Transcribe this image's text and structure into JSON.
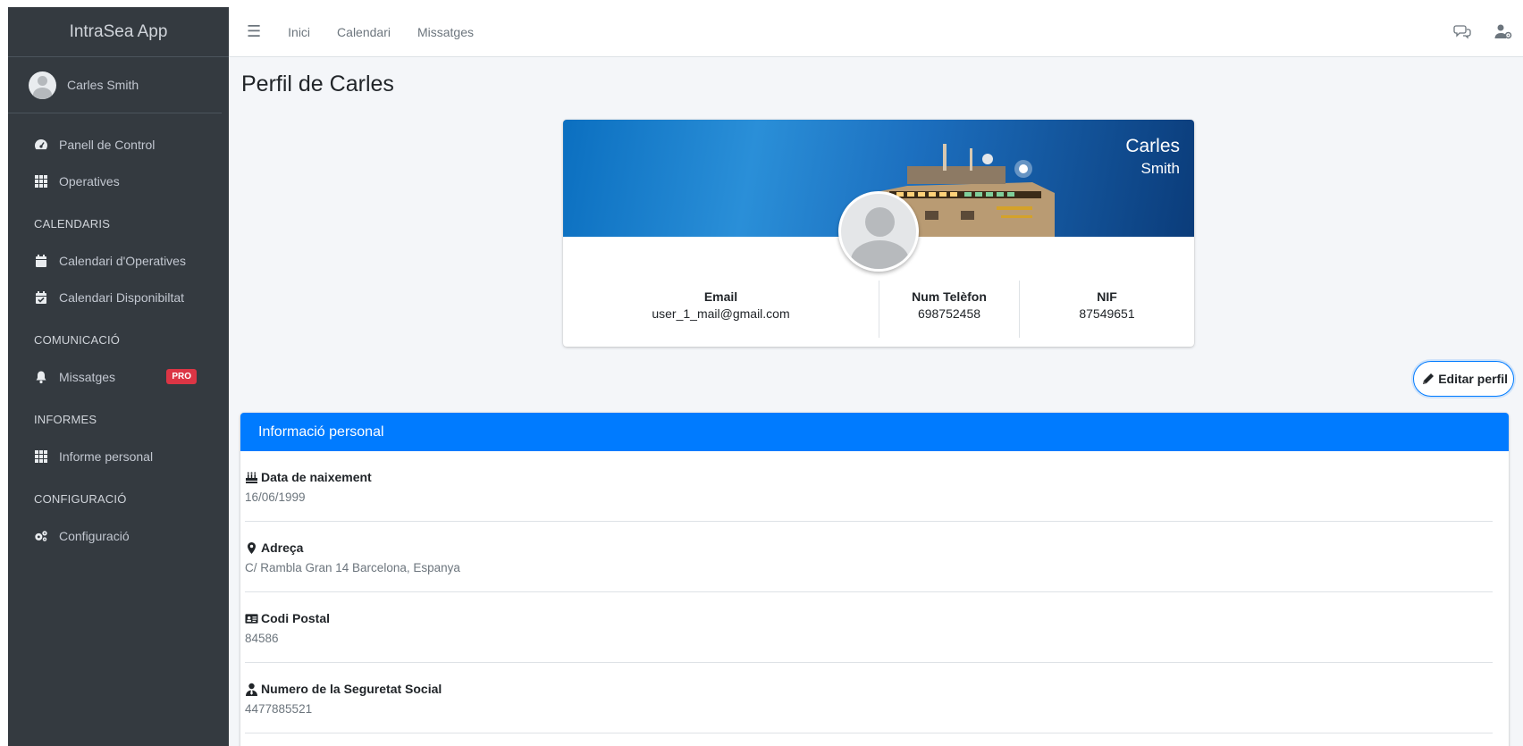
{
  "app": {
    "brand": "IntraSea App"
  },
  "sidebar": {
    "user_name": "Carles Smith",
    "items": [
      {
        "label": "Panell de Control"
      },
      {
        "label": "Operatives"
      }
    ],
    "sections": [
      {
        "header": "CALENDARIS",
        "items": [
          {
            "label": "Calendari d'Operatives"
          },
          {
            "label": "Calendari Disponibiltat"
          }
        ]
      },
      {
        "header": "COMUNICACIÓ",
        "items": [
          {
            "label": "Missatges",
            "badge": "PRO"
          }
        ]
      },
      {
        "header": "INFORMES",
        "items": [
          {
            "label": "Informe personal"
          }
        ]
      },
      {
        "header": "CONFIGURACIÓ",
        "items": [
          {
            "label": "Configuració"
          }
        ]
      }
    ]
  },
  "topbar": {
    "links": [
      {
        "label": "Inici"
      },
      {
        "label": "Calendari"
      },
      {
        "label": "Missatges"
      }
    ],
    "icons": [
      "chat-icon",
      "user-settings-icon"
    ]
  },
  "page": {
    "title": "Perfil de Carles"
  },
  "profile": {
    "first_name": "Carles",
    "last_name": "Smith",
    "stats": [
      {
        "label": "Email",
        "value": "user_1_mail@gmail.com"
      },
      {
        "label": "Num Telèfon",
        "value": "698752458"
      },
      {
        "label": "NIF",
        "value": "87549651"
      }
    ],
    "edit_label": "Editar perfil"
  },
  "personal_info": {
    "title": "Informació personal",
    "items": [
      {
        "label": "Data de naixement",
        "value": "16/06/1999",
        "icon": "birthday-cake-icon"
      },
      {
        "label": "Adreça",
        "value": "C/ Rambla Gran 14 Barcelona, Espanya",
        "icon": "map-marker-icon"
      },
      {
        "label": "Codi Postal",
        "value": "84586",
        "icon": "id-card-icon"
      },
      {
        "label": "Numero de la Seguretat Social",
        "value": "4477885521",
        "icon": "user-tie-icon"
      }
    ]
  },
  "colors": {
    "sidebar": "#343a40",
    "primary": "#007bff",
    "badge": "#dc3545",
    "content_bg": "#f4f6f9"
  }
}
